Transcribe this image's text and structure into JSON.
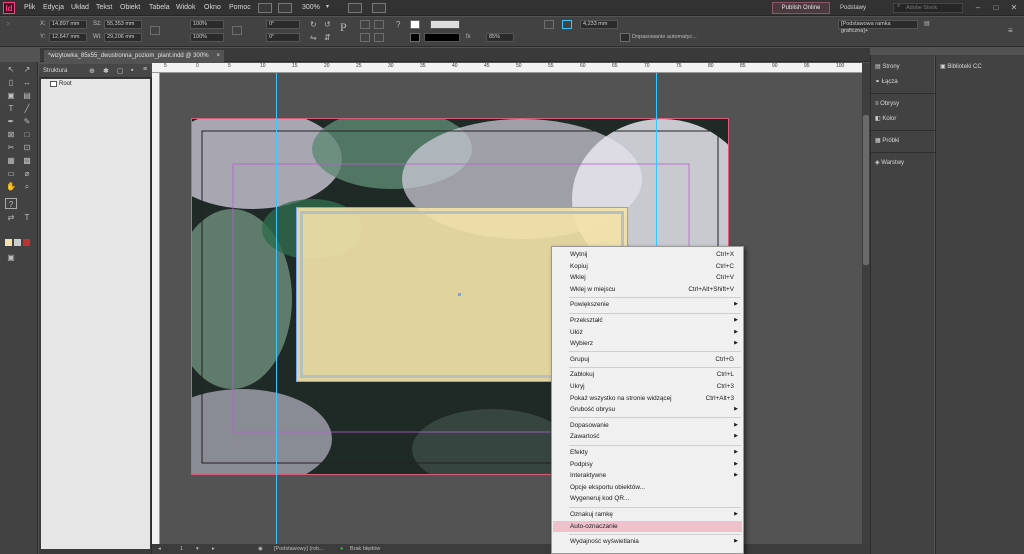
{
  "menubar": {
    "logo": "Id",
    "items": [
      "Plik",
      "Edycja",
      "Układ",
      "Tekst",
      "Obiekt",
      "Tabela",
      "Widok",
      "Okno",
      "Pomoc"
    ],
    "zoom": "300%",
    "publish": "Publish Online",
    "workspace": "Podstawy",
    "search_placeholder": "Adobe Stock"
  },
  "control": {
    "x_label": "X:",
    "x_value": "14,897 mm",
    "y_label": "Y:",
    "y_value": "12,647 mm",
    "w_label": "Sz:",
    "w_value": "55,353 mm",
    "h_label": "Wi:",
    "h_value": "29,206 mm",
    "scale_x": "100%",
    "scale_y": "100%",
    "angle1": "0°",
    "angle2": "0°",
    "stroke_weight": "4,233 mm",
    "opacity": "85%",
    "auto_fit": "Dopasowanie automatyc...",
    "frame_style": "[Podstawowa ramka graficzna]+"
  },
  "document": {
    "tab": "*wizytowka_85x55_dwustronna_poziom_plant.indd @ 300%"
  },
  "structure": {
    "title": "Struktura",
    "root": "Root"
  },
  "ruler": {
    "ticks": [
      "5",
      "0",
      "5",
      "10",
      "15",
      "20",
      "25",
      "30",
      "35",
      "40",
      "45",
      "50",
      "55",
      "60",
      "65",
      "70",
      "75",
      "80",
      "85",
      "90",
      "95",
      "100",
      "105"
    ]
  },
  "status": {
    "page": "1",
    "master": "[Podstawowy] (rob...",
    "errors": "Brak błędów"
  },
  "panels": {
    "right": [
      "Strony",
      "Łącza",
      "Obrysy",
      "Kolor",
      "Próbki",
      "Warstwy"
    ],
    "cc": "Biblioteki CC"
  },
  "context_menu": [
    {
      "label": "Wytnij",
      "shortcut": "Ctrl+X"
    },
    {
      "label": "Kopiuj",
      "shortcut": "Ctrl+C"
    },
    {
      "label": "Wklej",
      "shortcut": "Ctrl+V"
    },
    {
      "label": "Wklej w miejscu",
      "shortcut": "Ctrl+Alt+Shift+V"
    },
    {
      "sep": true
    },
    {
      "label": "Powiększenie",
      "sub": true
    },
    {
      "sep": true
    },
    {
      "label": "Przekształć",
      "sub": true
    },
    {
      "label": "Ułóż",
      "sub": true
    },
    {
      "label": "Wybierz",
      "sub": true
    },
    {
      "sep": true
    },
    {
      "label": "Grupuj",
      "shortcut": "Ctrl+G"
    },
    {
      "sep": true
    },
    {
      "label": "Zablokuj",
      "shortcut": "Ctrl+L"
    },
    {
      "label": "Ukryj",
      "shortcut": "Ctrl+3"
    },
    {
      "label": "Pokaż wszystko na stronie widzącej",
      "shortcut": "Ctrl+Alt+3"
    },
    {
      "label": "Grubość obrysu",
      "sub": true
    },
    {
      "sep": true
    },
    {
      "label": "Dopasowanie",
      "sub": true
    },
    {
      "label": "Zawartość",
      "sub": true
    },
    {
      "sep": true
    },
    {
      "label": "Efekty",
      "sub": true
    },
    {
      "label": "Podpisy",
      "sub": true
    },
    {
      "label": "Interaktywne",
      "sub": true
    },
    {
      "label": "Opcje eksportu obiektów..."
    },
    {
      "label": "Wygeneruj kod QR..."
    },
    {
      "sep": true
    },
    {
      "label": "Oznakuj ramkę",
      "sub": true
    },
    {
      "label": "Auto-oznaczanie",
      "highlight": true
    },
    {
      "sep": true
    },
    {
      "label": "Wydajność wyświetlania",
      "sub": true
    }
  ],
  "colors": {
    "accent": "#ff3d8b",
    "guide": "#3ac6ff",
    "highlight": "#efc1cc"
  }
}
